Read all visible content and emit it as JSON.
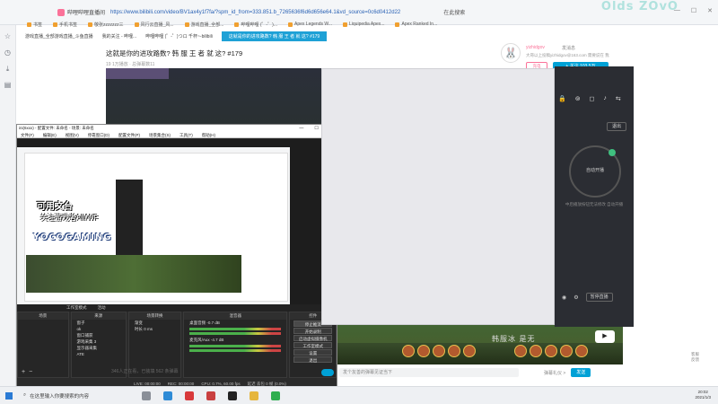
{
  "browser": {
    "tab_title": "哔哩哔哩直播间",
    "url": "https://www.bilibili.com/video/BV1ax4y1f7fa/?spm_id_from=333.851.b_7265636f6d6d656e64.1&vd_source=0c6d0412d22",
    "search_placeholder": "在此搜索",
    "watermark": "Olds ZOvO"
  },
  "bookmarks": [
    "书签",
    "手机书签",
    "敬张zzzzzzz三",
    "风行云直播_风...",
    "游戏直播_全部...",
    "哔哩哔哩 (゜-゜)...",
    "Apex Legends W...",
    "Liquipedia Apex...",
    "Apex Ranked In..."
  ],
  "tabs": [
    "游戏直播_全部游戏直播_斗鱼直播",
    "我的关注 - 哔哩...",
    "哔哩哔哩 (゜-゜)つロ 千杯~-bilibili",
    "这就是你的进攻路数? 韩 服 王 者 就 这? #179"
  ],
  "video": {
    "title": "这就是你的进攻路数? 韩 服 王 者 就 这? #179",
    "meta": "19  1万播放   · 总弹幕数11"
  },
  "uploader": {
    "name": "yizhidgov",
    "message": "发消息",
    "desc": "大哥以上投稿yizhidgov@163.com 需要说在 我",
    "charge": "充电",
    "follow": "+ 关注 103.5万"
  },
  "obs": {
    "title": "ini(6xxx) - 配置文件: 未命名 - 场景: 未命名",
    "menu": [
      "文件(F)",
      "编辑(E)",
      "视图(V)",
      "停靠窗口(D)",
      "配置文件(P)",
      "场景集合(S)",
      "工具(T)",
      "帮助(H)"
    ],
    "dock": [
      "工作室模式",
      "活动"
    ],
    "logo": {
      "line1": "可用文台",
      "line2": "关注游戏者AII/WF",
      "line3": "YOCOGAMING"
    },
    "panels": {
      "scenes_title": "场景",
      "sources_title": "来源",
      "sources": [
        "窗子",
        "ok",
        "窗口捕获",
        "游戏采集 3",
        "显示器采集",
        "ATE"
      ],
      "filters_title": "场景转换",
      "filter_items": [
        "渐变",
        "时长  0 ms"
      ],
      "mixer_title": "混音器",
      "mixer": [
        {
          "name": "桌面音频",
          "db": "-0.7 dB"
        },
        {
          "name": "麦克风/Aux",
          "db": "-4.7 dB"
        }
      ],
      "controls_title": "控件",
      "controls": [
        "停止推流",
        "开始录制",
        "启动虚拟摄像机",
        "工作室模式",
        "设置",
        "退出"
      ]
    },
    "status": [
      "LIVE: 00:00:00",
      "REC: 00:00:00",
      "CPU: 0.7%, 60.00 fps",
      "延迟 丢包 0 帧 (0.0%)"
    ]
  },
  "live_panel": {
    "exit": "退出",
    "label": "自动开播",
    "note": "中后播放按钮无法修改 自动开播",
    "stop": "暂停直播"
  },
  "video_overlay": {
    "text": "韩服冰 是无",
    "play": "▶"
  },
  "danmaku": {
    "viewers": "346人正在看，已装填 562 条弹幕",
    "placeholder": "发个友善的弹幕见证当下",
    "etiquette": "弹幕礼仪 >",
    "send": "发送"
  },
  "right_side": [
    "客服",
    "反馈"
  ],
  "taskbar": {
    "search": "在这里输入你要搜索的内容",
    "time": "20:02",
    "date": "2021/1/3"
  }
}
